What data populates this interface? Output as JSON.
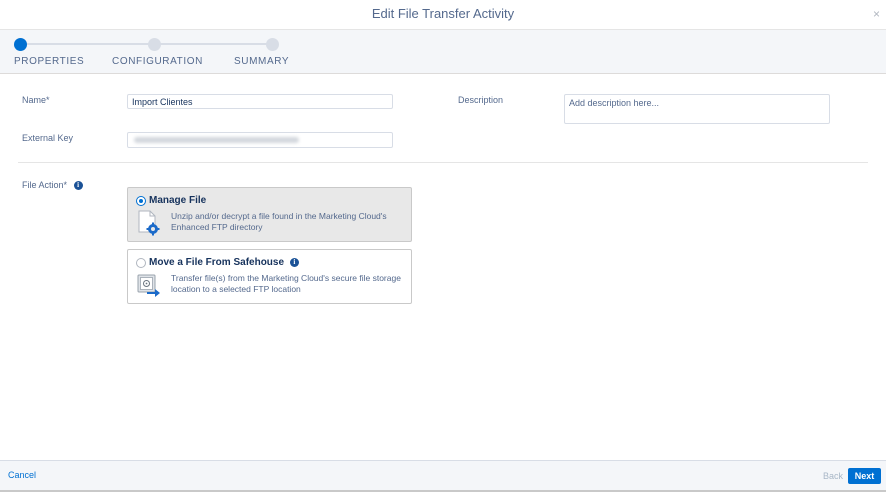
{
  "dialog": {
    "title": "Edit File Transfer Activity",
    "close_glyph": "×"
  },
  "steps": [
    {
      "label": "PROPERTIES",
      "active": true
    },
    {
      "label": "CONFIGURATION",
      "active": false
    },
    {
      "label": "SUMMARY",
      "active": false
    }
  ],
  "form": {
    "name_label": "Name*",
    "name_value": "Import Clientes",
    "external_key_label": "External Key",
    "description_label": "Description",
    "description_placeholder": "Add description here...",
    "file_action_label": "File Action*",
    "info_glyph": "i"
  },
  "file_actions": [
    {
      "title": "Manage File",
      "description": "Unzip and/or decrypt a file found in the Marketing Cloud's Enhanced FTP directory",
      "selected": true,
      "icon": "file-gear-icon"
    },
    {
      "title": "Move a File From Safehouse",
      "description": "Transfer file(s) from the Marketing Cloud's secure file storage location to a selected FTP location",
      "selected": false,
      "icon": "safe-arrow-icon"
    }
  ],
  "footer": {
    "cancel_label": "Cancel",
    "back_label": "Back",
    "next_label": "Next"
  },
  "colors": {
    "brand_blue": "#0070d2",
    "info_blue": "#1b5297",
    "label_gray": "#54698d"
  }
}
